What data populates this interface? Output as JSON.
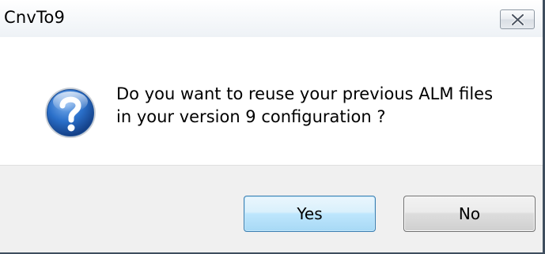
{
  "window": {
    "title": "CnvTo9"
  },
  "dialog": {
    "icon": "question-icon",
    "message_lines": [
      "Do you want to reuse your previous ALM files",
      "in your version 9 configuration ?"
    ]
  },
  "buttons": {
    "yes_label": "Yes",
    "no_label": "No"
  },
  "icons": {
    "close": "close-icon"
  },
  "colors": {
    "accent": "#3c7fb1",
    "footer_bg": "#f0f0f0",
    "icon_blue": "#2a6fc9"
  }
}
